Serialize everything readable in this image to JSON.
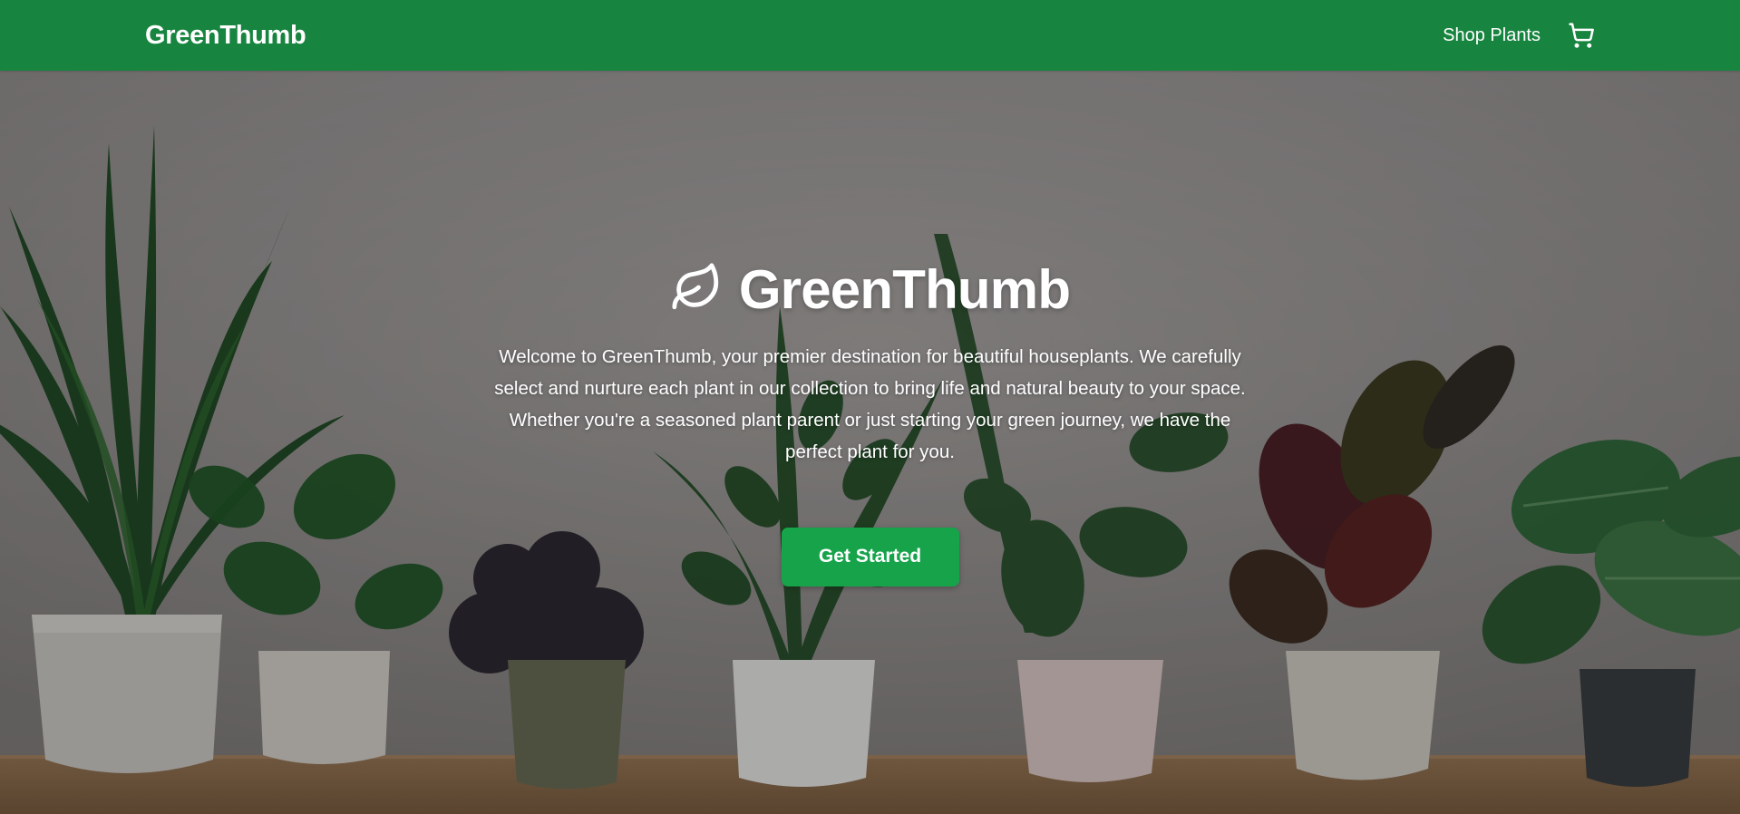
{
  "navbar": {
    "brand": "GreenThumb",
    "links": [
      {
        "label": "Shop Plants"
      }
    ],
    "cart_icon": "shopping-cart-icon",
    "background_color": "#17843f"
  },
  "hero": {
    "icon": "leaf-icon",
    "title": "GreenThumb",
    "description": "Welcome to GreenThumb, your premier destination for beautiful houseplants. We carefully select and nurture each plant in our collection to bring life and natural beauty to your space. Whether you're a seasoned plant parent or just starting your green journey, we have the perfect plant for you.",
    "cta_label": "Get Started",
    "cta_color": "#16a34a"
  }
}
